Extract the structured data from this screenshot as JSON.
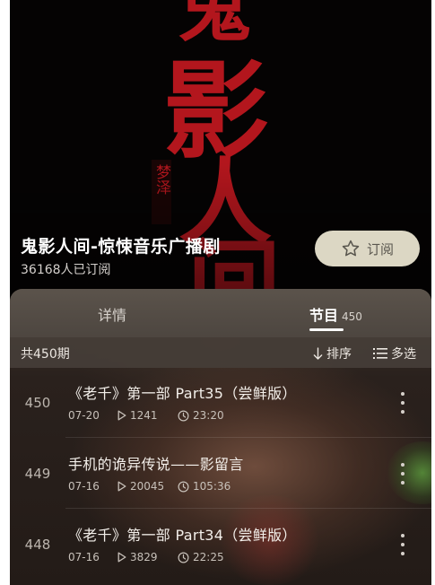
{
  "album": {
    "title": "鬼影人间-惊悚音乐广播剧",
    "subscribers": "36168人已订阅",
    "subscribe_label": "订阅",
    "cover_text": {
      "line1": "鬼",
      "line2": "影",
      "line3": "人",
      "line4": "间",
      "seal": "梦泽"
    }
  },
  "tabs": {
    "detail": "详情",
    "programs": "节目",
    "programs_count": "450"
  },
  "list": {
    "total": "共450期",
    "sort_label": "排序",
    "multi_label": "多选"
  },
  "episodes": [
    {
      "number": "450",
      "title": "《老千》第一部 Part35（尝鲜版）",
      "date": "07-20",
      "plays": "1241",
      "duration": "23:20"
    },
    {
      "number": "449",
      "title": "手机的诡异传说——影留言",
      "date": "07-16",
      "plays": "20045",
      "duration": "105:36"
    },
    {
      "number": "448",
      "title": "《老千》第一部 Part34（尝鲜版）",
      "date": "07-16",
      "plays": "3829",
      "duration": "22:25"
    }
  ],
  "colors": {
    "cover_red": "#b3161d",
    "subscribe_bg": "#dcd7c4",
    "background": "#060404"
  },
  "icons": {
    "subscribe": "star-icon",
    "sort": "arrow-down-icon",
    "multi": "list-icon",
    "plays": "play-icon",
    "duration": "clock-icon",
    "more": "more-vertical-icon"
  }
}
